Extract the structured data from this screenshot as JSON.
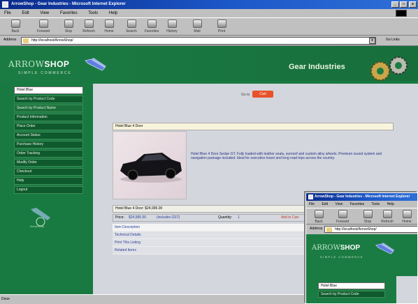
{
  "window": {
    "title": "ArrowShop - Gear Industries - Microsoft Internet Explorer",
    "buttons": [
      "_",
      "□",
      "x"
    ]
  },
  "menu": [
    "File",
    "Edit",
    "View",
    "Favorites",
    "Tools",
    "Help"
  ],
  "toolbar": {
    "buttons": [
      "Back",
      "Forward",
      "Stop",
      "Refresh",
      "Home",
      "Search",
      "Favorites",
      "History",
      "Mail",
      "Print"
    ]
  },
  "address": {
    "label": "Address",
    "url": "http://localhost/ArrowShop/",
    "go_links": "Go Links"
  },
  "header": {
    "logo_main": "ARROW",
    "logo_shop": "SHOP",
    "logo_sub": "SIMPLE COMMERCE",
    "company": "Gear Industries"
  },
  "sidebar": {
    "search_value": "Hotel Blue",
    "items": [
      "Search by Product Code",
      "Search by Product Name",
      "Product Information",
      "Place Order",
      "Account Status",
      "Purchase History",
      "Order Tracking",
      "Modify Order",
      "Checkout",
      "Help",
      "Logout"
    ],
    "logo_caption": "ArrowShop"
  },
  "main": {
    "cart_lead": "Go to",
    "cart_button": "Cart",
    "detail_header": "Hotel Blue 4 Door",
    "description": "Hotel Blue 4 Door Sedan GT. Fully loaded with leather seats, sunroof and custom alloy wheels. Premium sound system and navigation package included. Ideal for executive travel and long road trips across the country.",
    "price_bar": "Hotel Blue 4 Door: $24,995.00",
    "info": {
      "price_label": "Price:",
      "price_value": "$24,995.00",
      "price_note": "(includes GST)",
      "qty_label": "Quantity:",
      "qty_value": "1",
      "add_link": "Add to Cart"
    },
    "links": [
      "Item Description",
      "Technical Details",
      "Print This Listing",
      "Related Items"
    ]
  },
  "status": {
    "text": "Done"
  },
  "overlay": {
    "title": "ArrowShop - Gear Industries - Microsoft Internet Explorer",
    "menu": [
      "File",
      "Edit",
      "View",
      "Favorites",
      "Tools",
      "Help"
    ],
    "toolbar": [
      "Back",
      "Forward",
      "Stop",
      "Refresh",
      "Home"
    ],
    "address_label": "Address",
    "url": "http://localhost/ArrowShop/",
    "logo_main": "ARROW",
    "logo_shop": "SHOP",
    "logo_sub": "SIMPLE COMMERCE",
    "side_items": [
      "Hotel Blue",
      "Search by Product Code"
    ]
  },
  "colors": {
    "site_green": "#187a40",
    "nav_dark": "#0f5a2c",
    "cart_orange": "#e8522b",
    "titlebar_blue": "#1c58c8"
  }
}
